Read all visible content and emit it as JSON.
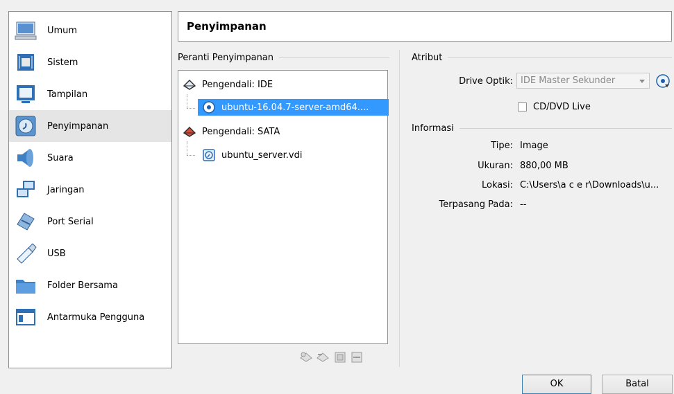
{
  "sidebar": {
    "items": [
      {
        "label": "Umum",
        "icon": "monitor-general-icon"
      },
      {
        "label": "Sistem",
        "icon": "system-chip-icon"
      },
      {
        "label": "Tampilan",
        "icon": "display-monitor-icon"
      },
      {
        "label": "Penyimpanan",
        "icon": "storage-disk-icon",
        "selected": true
      },
      {
        "label": "Suara",
        "icon": "speaker-icon"
      },
      {
        "label": "Jaringan",
        "icon": "network-icon"
      },
      {
        "label": "Port Serial",
        "icon": "serial-port-icon"
      },
      {
        "label": "USB",
        "icon": "usb-icon"
      },
      {
        "label": "Folder Bersama",
        "icon": "shared-folder-icon"
      },
      {
        "label": "Antarmuka Pengguna",
        "icon": "user-interface-icon"
      }
    ]
  },
  "header": {
    "title": "Penyimpanan"
  },
  "storage": {
    "group_title": "Peranti Penyimpanan",
    "tree": [
      {
        "label": "Pengendali: IDE",
        "type": "controller"
      },
      {
        "label": "ubuntu-16.04.7-server-amd64....",
        "type": "optical",
        "selected": true
      },
      {
        "label": "Pengendali: SATA",
        "type": "controller"
      },
      {
        "label": "ubuntu_server.vdi",
        "type": "disk"
      }
    ]
  },
  "attributes": {
    "group_title": "Atribut",
    "drive_label": "Drive Optik:",
    "drive_value": "IDE Master Sekunder",
    "live_label": "CD/DVD Live",
    "live_checked": false
  },
  "info": {
    "group_title": "Informasi",
    "rows": [
      {
        "label": "Tipe:",
        "value": "Image"
      },
      {
        "label": "Ukuran:",
        "value": "880,00 MB"
      },
      {
        "label": "Lokasi:",
        "value": "C:\\Users\\a c e r\\Downloads\\u..."
      },
      {
        "label": "Terpasang Pada:",
        "value": "--"
      }
    ]
  },
  "buttons": {
    "ok": "OK",
    "cancel": "Batal"
  },
  "colors": {
    "selection": "#3399ff",
    "accent_blue": "#2f6fb5"
  }
}
